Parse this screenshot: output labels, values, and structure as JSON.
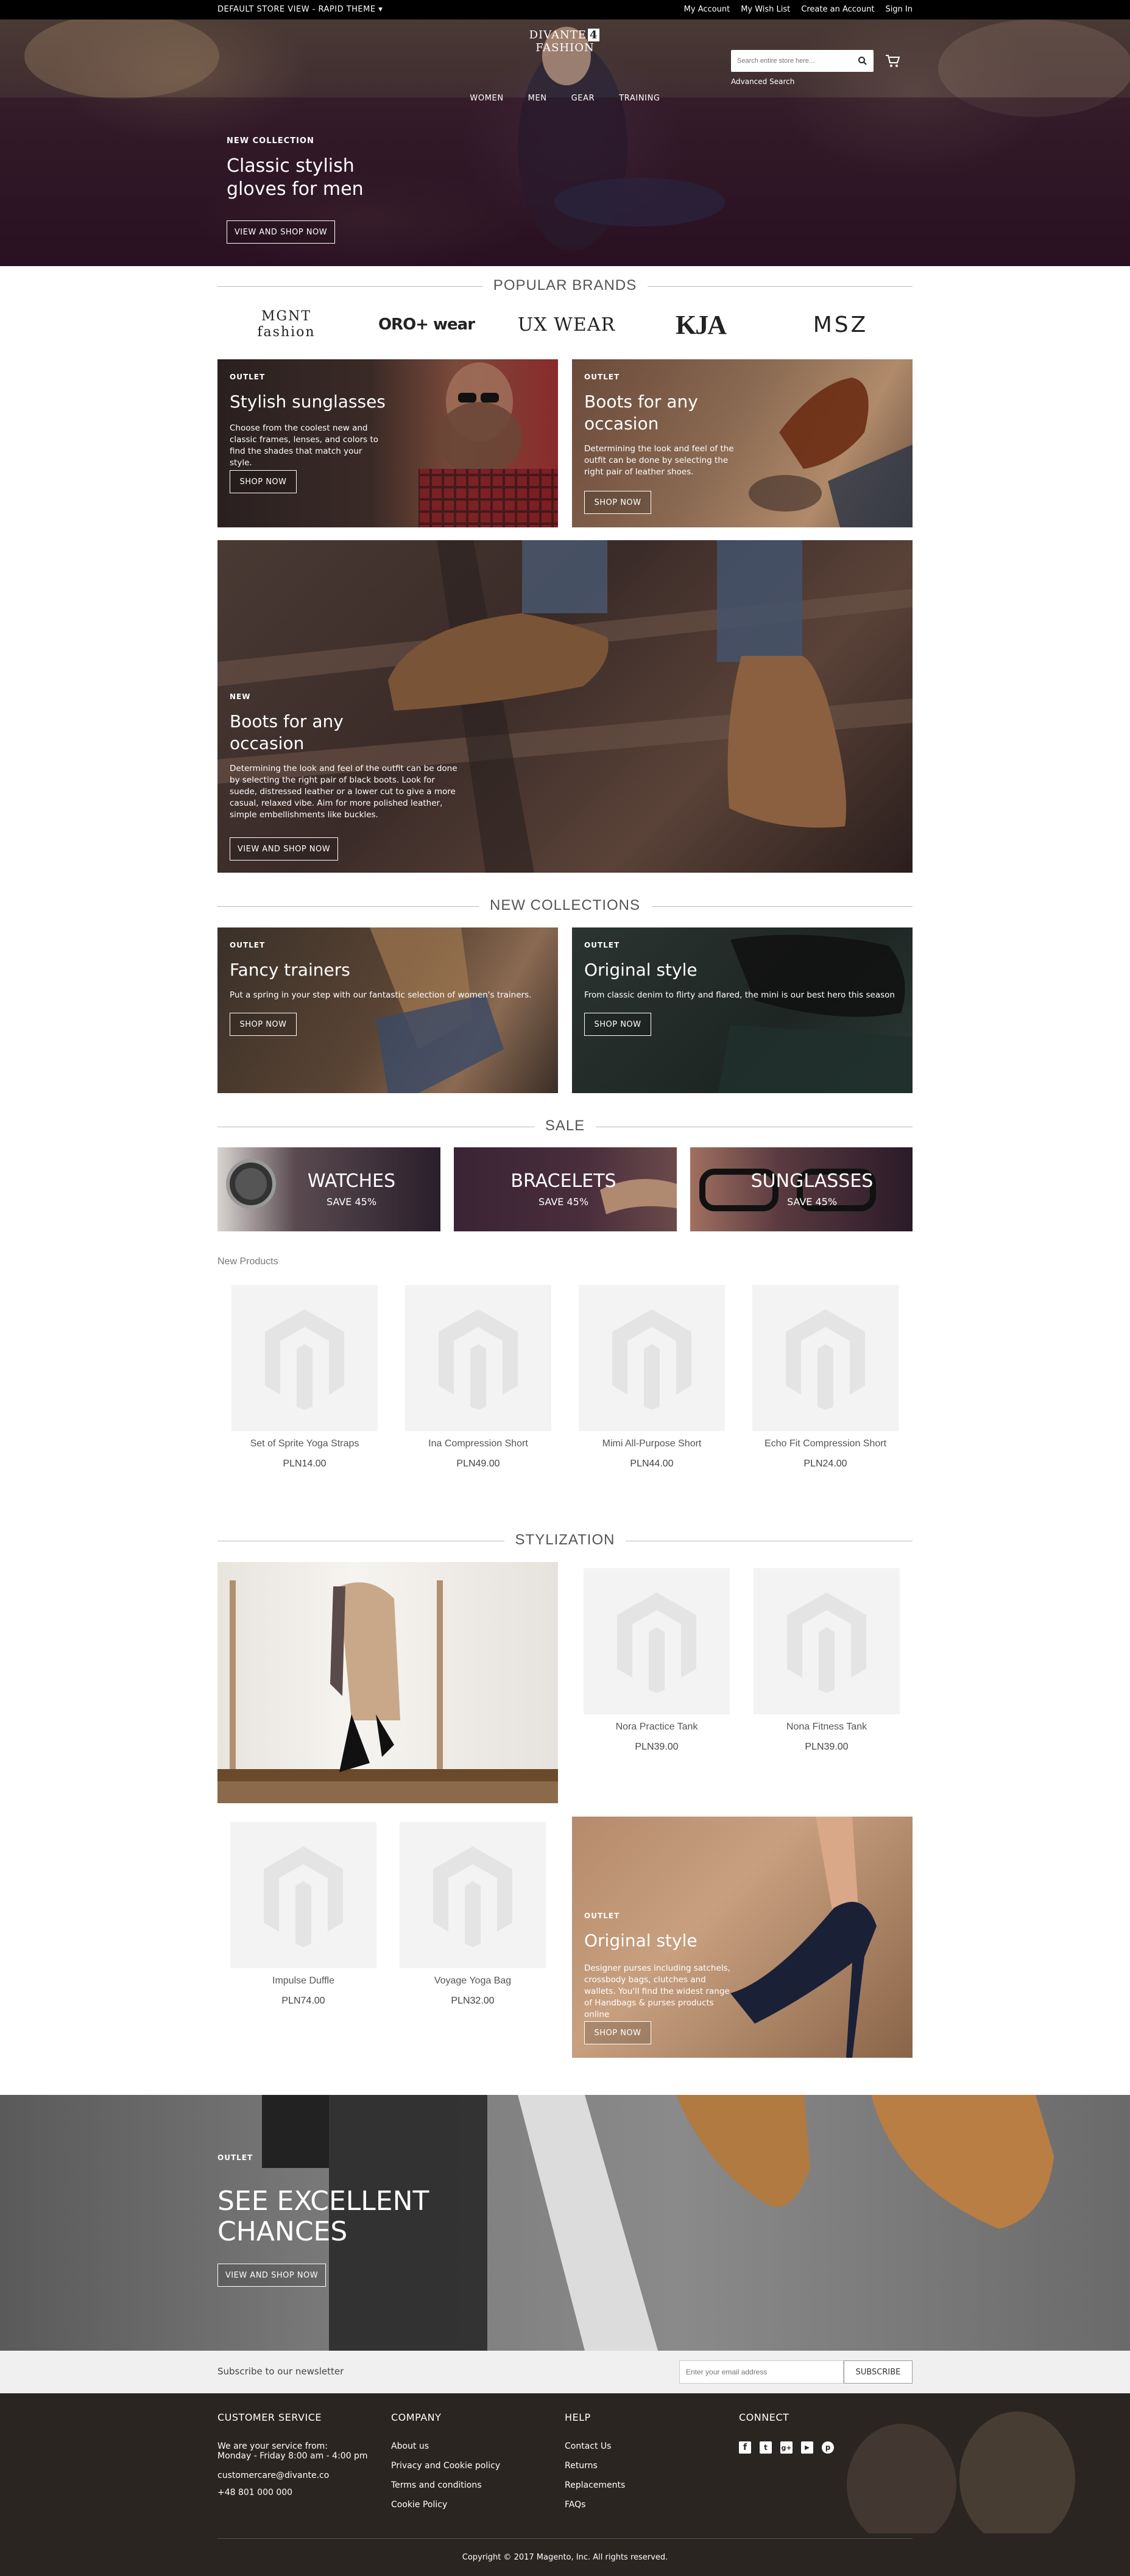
{
  "topbar": {
    "store_label": "DEFAULT STORE VIEW - RAPID THEME",
    "links": [
      "My Account",
      "My Wish List",
      "Create an Account",
      "Sign In"
    ]
  },
  "header": {
    "logo_left": "DIVANTE",
    "logo_mid": "4",
    "logo_right": "FASHION",
    "search_placeholder": "Search entire store here...",
    "advanced_search": "Advanced Search",
    "nav": [
      "WOMEN",
      "MEN",
      "GEAR",
      "TRAINING"
    ]
  },
  "hero": {
    "tag": "NEW COLLECTION",
    "title": "Classic stylish gloves for men",
    "button": "VIEW AND SHOP NOW"
  },
  "popular_brands": {
    "heading": "POPULAR BRANDS",
    "brands": [
      "MGNT fashion",
      "ORO+ wear",
      "UX WEAR",
      "KJA",
      "MSZ"
    ]
  },
  "promo": {
    "sunglasses": {
      "tag": "OUTLET",
      "title": "Stylish sunglasses",
      "text": "Choose from the coolest new and classic frames, lenses, and colors to find the shades that match your style.",
      "button": "SHOP NOW"
    },
    "boots": {
      "tag": "OUTLET",
      "title": "Boots for any occasion",
      "text": "Determining the look and feel of the outfit can be done by selecting the right pair of leather shoes.",
      "button": "SHOP NOW"
    },
    "big": {
      "tag": "NEW",
      "title": "Boots for any occasion",
      "text": "Determining the look and feel of the outfit can be done by selecting the right pair of black boots. Look for suede, distressed leather or a lower cut to give a more casual, relaxed vibe. Aim for more polished leather, simple embellishments like buckles.",
      "button": "VIEW AND SHOP NOW"
    }
  },
  "new_collections": {
    "heading": "NEW COLLECTIONS",
    "trainers": {
      "tag": "OUTLET",
      "title": "Fancy trainers",
      "text": "Put a spring in your step with our fantastic selection of women's trainers.",
      "button": "SHOP NOW"
    },
    "original": {
      "tag": "OUTLET",
      "title": "Original style",
      "text": "From classic denim to flirty and flared, the mini is our best hero this season",
      "button": "SHOP NOW"
    }
  },
  "sale": {
    "heading": "SALE",
    "items": [
      {
        "title": "WATCHES",
        "sub": "SAVE 45%"
      },
      {
        "title": "BRACELETS",
        "sub": "SAVE 45%"
      },
      {
        "title": "SUNGLASSES",
        "sub": "SAVE 45%"
      }
    ]
  },
  "new_products": {
    "heading": "New Products",
    "items": [
      {
        "name": "Set of Sprite Yoga Straps",
        "price": "PLN14.00"
      },
      {
        "name": "Ina Compression Short",
        "price": "PLN49.00"
      },
      {
        "name": "Mimi All-Purpose Short",
        "price": "PLN44.00"
      },
      {
        "name": "Echo Fit Compression Short",
        "price": "PLN24.00"
      }
    ]
  },
  "stylization": {
    "heading": "STYLIZATION",
    "items": [
      {
        "name": "Nora Practice Tank",
        "price": "PLN39.00"
      },
      {
        "name": "Nona Fitness Tank",
        "price": "PLN39.00"
      },
      {
        "name": "Impulse Duffle",
        "price": "PLN74.00"
      },
      {
        "name": "Voyage Yoga Bag",
        "price": "PLN32.00"
      }
    ],
    "card": {
      "tag": "OUTLET",
      "title": "Original style",
      "text": "Designer purses including satchels, crossbody bags, clutches and wallets. You'll find the widest range of Handbags & purses products online",
      "button": "SHOP NOW"
    }
  },
  "banner": {
    "tag": "OUTLET",
    "title": "SEE EXCELLENT CHANCES",
    "button": "VIEW AND SHOP NOW"
  },
  "newsletter": {
    "label": "Subscribe to our newsletter",
    "placeholder": "Enter your email address",
    "button": "SUBSCRIBE"
  },
  "footer": {
    "customer_service": {
      "heading": "CUSTOMER SERVICE",
      "lines": [
        "We are your service from:",
        "Monday - Friday 8:00 am - 4:00 pm",
        "customercare@divante.co",
        "+48 801 000 000"
      ]
    },
    "company": {
      "heading": "COMPANY",
      "links": [
        "About us",
        "Privacy and Cookie policy",
        "Terms and conditions",
        "Cookie Policy"
      ]
    },
    "help": {
      "heading": "HELP",
      "links": [
        "Contact Us",
        "Returns",
        "Replacements",
        "FAQs"
      ]
    },
    "connect": {
      "heading": "CONNECT",
      "icons": [
        "facebook-icon",
        "twitter-icon",
        "google-plus-icon",
        "youtube-icon",
        "pinterest-icon"
      ]
    },
    "copyright": "Copyright © 2017 Magento, Inc. All rights reserved."
  }
}
